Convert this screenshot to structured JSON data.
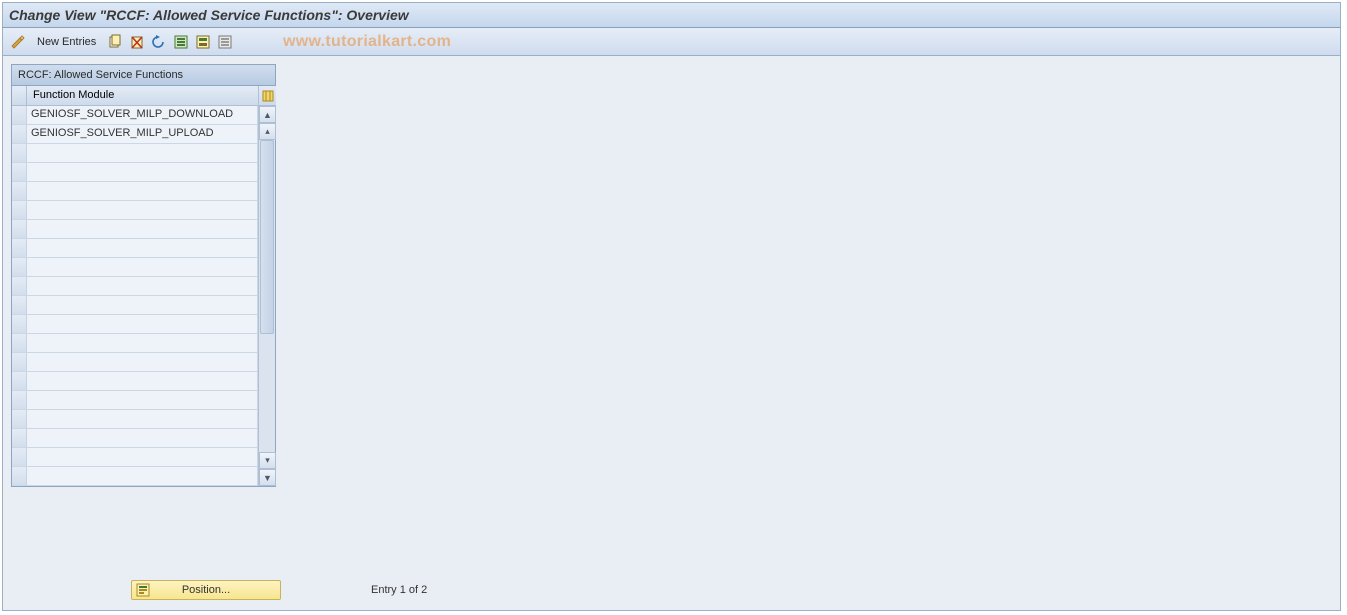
{
  "title": "Change View \"RCCF: Allowed Service Functions\": Overview",
  "toolbar": {
    "new_entries_label": "New Entries"
  },
  "watermark": "www.tutorialkart.com",
  "panel": {
    "title": "RCCF: Allowed Service Functions",
    "column_header": "Function Module",
    "rows": [
      "GENIOSF_SOLVER_MILP_DOWNLOAD",
      "GENIOSF_SOLVER_MILP_UPLOAD",
      "",
      "",
      "",
      "",
      "",
      "",
      "",
      "",
      "",
      "",
      "",
      "",
      "",
      "",
      "",
      "",
      "",
      ""
    ]
  },
  "footer": {
    "position_label": "Position...",
    "entry_text": "Entry 1 of 2"
  }
}
